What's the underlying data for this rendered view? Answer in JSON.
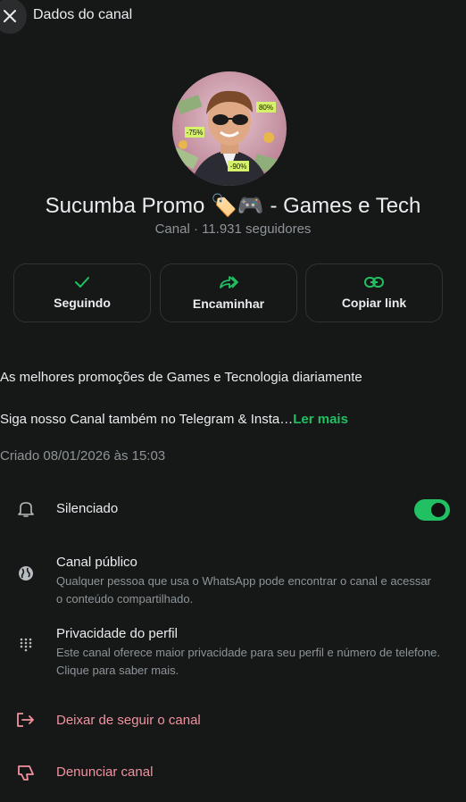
{
  "header": {
    "title": "Dados do canal"
  },
  "channel": {
    "name": "Sucumba Promo 🏷️🎮 - Games e Tech",
    "meta": "Canal · 11.931 seguidores"
  },
  "actions": [
    {
      "label": "Seguindo",
      "icon": "check-icon"
    },
    {
      "label": "Encaminhar",
      "icon": "forward-icon"
    },
    {
      "label": "Copiar link",
      "icon": "link-icon"
    }
  ],
  "description": {
    "line1": "As melhores promoções de Games e Tecnologia diariamente",
    "line2": "Siga nosso Canal também no Telegram & Insta…",
    "more": "Ler mais"
  },
  "created": "Criado 08/01/2026 às 15:03",
  "settings": {
    "muted": {
      "title": "Silenciado",
      "enabled": true
    },
    "public": {
      "title": "Canal público",
      "sub": "Qualquer pessoa que usa o WhatsApp pode encontrar o canal e acessar o conteúdo compartilhado."
    },
    "privacy": {
      "title": "Privacidade do perfil",
      "sub": "Este canal oferece maior privacidade para seu perfil e número de telefone. Clique para saber mais."
    }
  },
  "danger": {
    "unfollow": "Deixar de seguir o canal",
    "report": "Denunciar canal"
  },
  "avatar_labels": [
    "80%",
    "-75%",
    "-90%"
  ],
  "colors": {
    "accent": "#21c063",
    "danger": "#f1939f",
    "background": "#161717"
  }
}
